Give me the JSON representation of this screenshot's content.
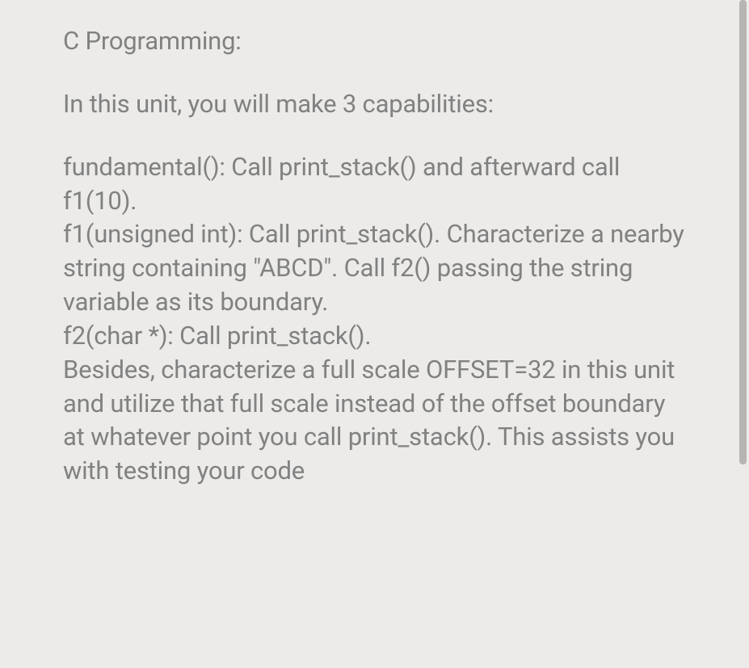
{
  "content": {
    "heading": "C Programming:",
    "intro": "In this unit, you will make 3 capabilities:",
    "body_line1": "fundamental(): Call print_stack() and afterward call f1(10).",
    "body_line2": "f1(unsigned int): Call print_stack(). Characterize a nearby string containing \"ABCD\". Call f2() passing the string variable as its boundary.",
    "body_line3": "f2(char *): Call print_stack().",
    "body_line4": "Besides, characterize a full scale OFFSET=32 in this unit and utilize that full scale instead of the offset boundary at whatever point you call print_stack(). This assists you with testing your code"
  }
}
